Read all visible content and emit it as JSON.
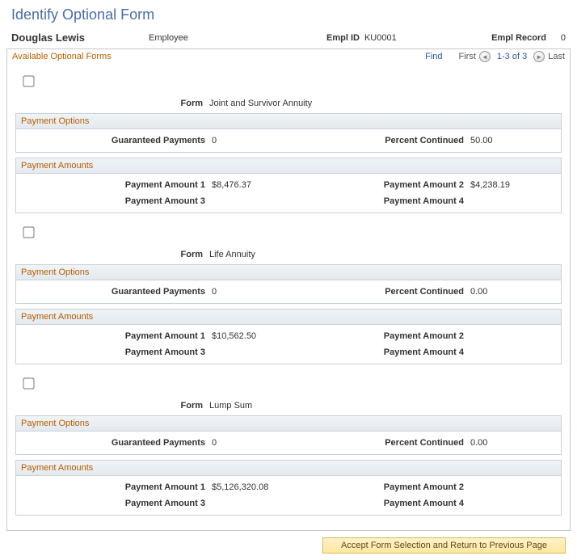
{
  "page": {
    "title": "Identify Optional Form"
  },
  "header": {
    "name": "Douglas Lewis",
    "role": "Employee",
    "emplid_label": "Empl ID",
    "emplid": "KU0001",
    "emplrec_label": "Empl Record",
    "emplrec": "0"
  },
  "grid": {
    "title": "Available Optional Forms",
    "find": "Find",
    "first": "First",
    "range": "1-3 of 3",
    "last": "Last"
  },
  "labels": {
    "form": "Form",
    "payment_options": "Payment Options",
    "payment_amounts": "Payment Amounts",
    "guaranteed_payments": "Guaranteed Payments",
    "percent_continued": "Percent Continued",
    "pa1": "Payment Amount 1",
    "pa2": "Payment Amount 2",
    "pa3": "Payment Amount 3",
    "pa4": "Payment Amount 4"
  },
  "forms": [
    {
      "name": "Joint and Survivor Annuity",
      "guaranteed_payments": "0",
      "percent_continued": "50.00",
      "pa1": "$8,476.37",
      "pa2": "$4,238.19",
      "pa3": "",
      "pa4": ""
    },
    {
      "name": "Life Annuity",
      "guaranteed_payments": "0",
      "percent_continued": "0.00",
      "pa1": "$10,562.50",
      "pa2": "",
      "pa3": "",
      "pa4": ""
    },
    {
      "name": "Lump Sum",
      "guaranteed_payments": "0",
      "percent_continued": "0.00",
      "pa1": "$5,126,320.08",
      "pa2": "",
      "pa3": "",
      "pa4": ""
    }
  ],
  "footer": {
    "accept": "Accept Form Selection and Return to Previous Page"
  }
}
